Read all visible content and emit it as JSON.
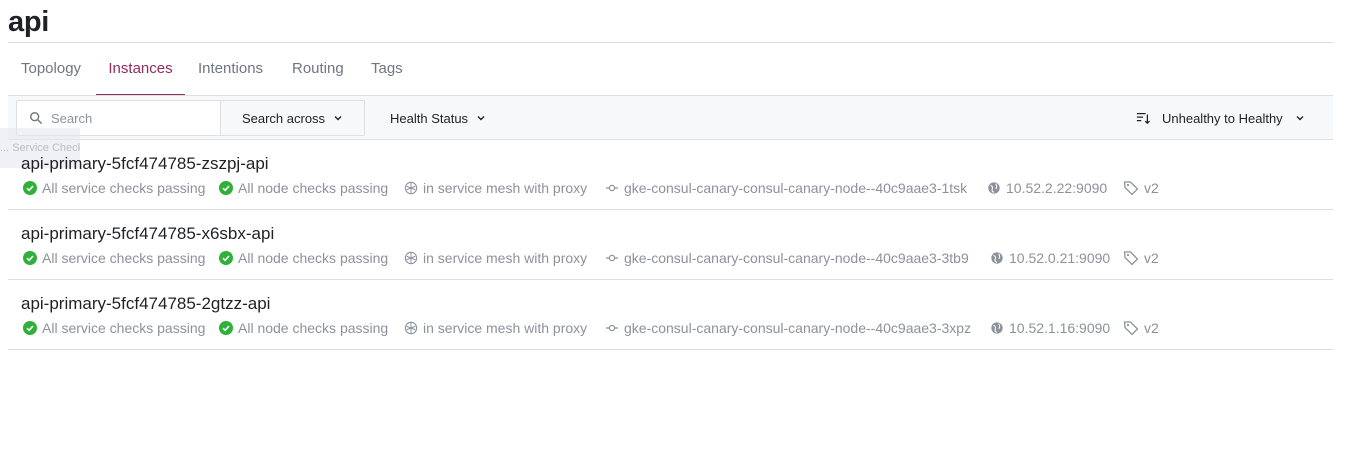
{
  "page": {
    "title": "api"
  },
  "tabs": [
    {
      "label": "Topology",
      "active": false
    },
    {
      "label": "Instances",
      "active": true
    },
    {
      "label": "Intentions",
      "active": false
    },
    {
      "label": "Routing",
      "active": false
    },
    {
      "label": "Tags",
      "active": false
    }
  ],
  "toolbar": {
    "search_placeholder": "Search",
    "search_across_label": "Search across",
    "health_status_label": "Health Status",
    "sort_label": "Unhealthy to Healthy"
  },
  "ghost_text": "... Service Checks",
  "instances": [
    {
      "name": "api-primary-5fcf474785-zszpj-api",
      "service_checks": "All service checks passing",
      "node_checks": "All node checks passing",
      "mesh": "in service mesh with proxy",
      "node": "gke-consul-canary-consul-canary-node--40c9aae3-1tsk",
      "address": "10.52.2.22:9090",
      "tags": "v2"
    },
    {
      "name": "api-primary-5fcf474785-x6sbx-api",
      "service_checks": "All service checks passing",
      "node_checks": "All node checks passing",
      "mesh": "in service mesh with proxy",
      "node": "gke-consul-canary-consul-canary-node--40c9aae3-3tb9",
      "address": "10.52.0.21:9090",
      "tags": "v2"
    },
    {
      "name": "api-primary-5fcf474785-2gtzz-api",
      "service_checks": "All service checks passing",
      "node_checks": "All node checks passing",
      "mesh": "in service mesh with proxy",
      "node": "gke-consul-canary-consul-canary-node--40c9aae3-3xpz",
      "address": "10.52.1.16:9090",
      "tags": "v2"
    }
  ],
  "colors": {
    "accent": "#8e2d5e",
    "passing": "#2eb039",
    "muted": "#8c919b"
  },
  "icons": {
    "passing": "check-circle-icon",
    "mesh": "mesh-icon",
    "node": "node-icon",
    "address": "globe-icon",
    "tags": "tag-icon"
  }
}
